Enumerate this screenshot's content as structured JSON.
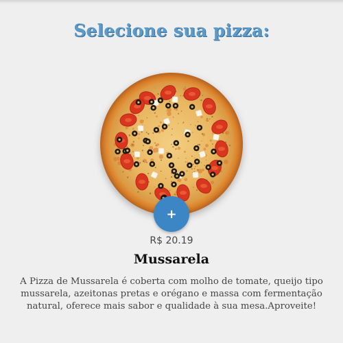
{
  "header": {
    "title": "Selecione sua pizza:"
  },
  "pizza": {
    "image_icon": "pizza-icon",
    "add_label": "+",
    "price": "R$ 20.19",
    "name": "Mussarela",
    "description": "A Pizza de Mussarela é coberta com molho de tomate, queijo tipo mussarela, azeitonas pretas e orégano e massa com fermentação natural, oferece mais sabor e qualidade à sua mesa.Aproveite!"
  },
  "colors": {
    "title": "#5b9ac9",
    "accent_button": "#3d86c6",
    "background": "#efefef"
  }
}
